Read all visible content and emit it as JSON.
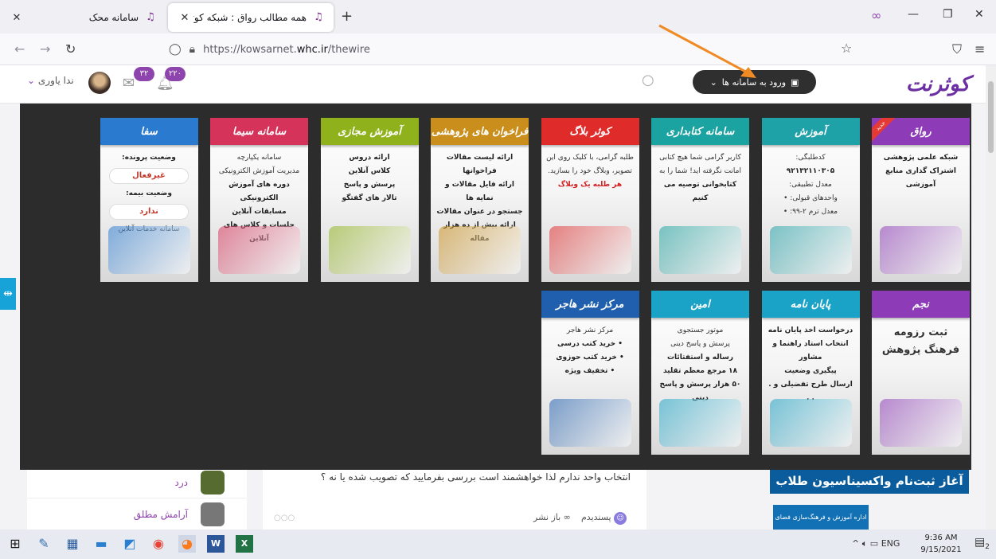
{
  "browser": {
    "tabs": [
      {
        "title": "سامانه محک",
        "active": false
      },
      {
        "title": "همه مطالب رواق : شبکه کوثر نت",
        "active": true
      }
    ],
    "new_tab": "+",
    "url_prefix": "https://kowsarnet.",
    "url_host": "whc.ir",
    "url_path": "/thewire"
  },
  "header": {
    "logo": "کوثرنت",
    "systems_button": "ورود به سامانه ها",
    "user_name": "ندا یاوری",
    "notif_count": "۲۲۰",
    "msg_count": "۳۲"
  },
  "cards_row1": [
    {
      "title": "رواق",
      "color": "#8e3bb8",
      "new": "جدید",
      "lines": [
        {
          "t": "شبکه علمی پژوهشی",
          "s": "bold"
        },
        {
          "t": "اشتراک گذاری منابع آموزشی",
          "s": "bold"
        }
      ]
    },
    {
      "title": "آموزش",
      "color": "#1fa1a8",
      "lines": [
        {
          "t": "کدطلبگی:",
          "s": ""
        },
        {
          "t": "۹۲۱۳۲۱۱۰۳۰۵",
          "s": "bold"
        },
        {
          "t": "معدل تطبیقی:",
          "s": ""
        },
        {
          "t": "واحدهای قبولی: •",
          "s": ""
        },
        {
          "t": "معدل ترم ۲-۹۹: •",
          "s": ""
        }
      ]
    },
    {
      "title": "سامانه کتابداری",
      "color": "#1aa3a0",
      "lines": [
        {
          "t": "کاربر گرامی شما هیچ کتابی",
          "s": ""
        },
        {
          "t": "امانت نگرفته اید! شما را به",
          "s": ""
        },
        {
          "t": "کتابخوانی توصیه می کنیم",
          "s": "bold"
        }
      ]
    },
    {
      "title": "کوثر بلاگ",
      "color": "#e02b2b",
      "lines": [
        {
          "t": "طلبه گرامی، با کلیک روی این",
          "s": ""
        },
        {
          "t": "تصویر، وبلاگ خود را بسازید.",
          "s": ""
        },
        {
          "t": "هر طلبه یک وبلاگ",
          "s": "red"
        }
      ]
    },
    {
      "title": "فراخوان های پژوهشی",
      "color": "#c98e1b",
      "lines": [
        {
          "t": "ارائه لیست مقالات فراخوانها",
          "s": "bold"
        },
        {
          "t": "ارائه فایل مقالات و نمایه ها",
          "s": "bold"
        },
        {
          "t": "جستجو در عنوان مقالات",
          "s": "bold"
        },
        {
          "t": "ارائه بیش از ده هزار مقاله",
          "s": "bold"
        }
      ]
    },
    {
      "title": "آموزش مجازی",
      "color": "#8fb21c",
      "lines": [
        {
          "t": "ارائه دروس",
          "s": "bold"
        },
        {
          "t": "کلاس آنلاین",
          "s": "bold"
        },
        {
          "t": "پرسش و پاسخ",
          "s": "bold"
        },
        {
          "t": "تالار های گفتگو",
          "s": "bold"
        }
      ]
    },
    {
      "title": "سامانه سیما",
      "color": "#d6335a",
      "lines": [
        {
          "t": "سامانه یکپارچه",
          "s": ""
        },
        {
          "t": "مدیریت آموزش الکترونیکی",
          "s": ""
        },
        {
          "t": "دوره های آموزش الکترونیکی",
          "s": "bold"
        },
        {
          "t": "مسابقات آنلاین",
          "s": "bold"
        },
        {
          "t": "جلسات و کلاس های آنلاین",
          "s": "bold"
        }
      ]
    },
    {
      "title": "سفا",
      "color": "#2a7ad0",
      "lines": [
        {
          "t": "وضعیت پرونده:",
          "s": "bold"
        },
        {
          "t": "غیرفعال",
          "s": "pill"
        },
        {
          "t": "وضعیت بیمه:",
          "s": "bold"
        },
        {
          "t": "ندارد",
          "s": "pill"
        },
        {
          "t": "سامانه خدمات آنلاین",
          "s": ""
        }
      ]
    }
  ],
  "cards_row2": [
    {
      "title": "نجم",
      "color": "#8e3bb8",
      "lines": [
        {
          "t": "ثبت رزومه",
          "s": "big"
        },
        {
          "t": "فرهنگ پژوهش",
          "s": "big"
        }
      ]
    },
    {
      "title": "پایان نامه",
      "color": "#1aa3c6",
      "lines": [
        {
          "t": "درخواست اخذ پایان نامه",
          "s": "bold"
        },
        {
          "t": "انتخاب استاد راهنما و مشاور",
          "s": "bold"
        },
        {
          "t": "پیگیری وضعیت",
          "s": "bold"
        },
        {
          "t": "ارسال طرح تفضیلی و . . .",
          "s": "bold"
        }
      ]
    },
    {
      "title": "امین",
      "color": "#1aa3c6",
      "lines": [
        {
          "t": "موتور جستجوی",
          "s": ""
        },
        {
          "t": "پرسش و پاسخ دینی",
          "s": ""
        },
        {
          "t": "رساله و استفتائات",
          "s": "bold"
        },
        {
          "t": "۱۸ مرجع معظم تقلید",
          "s": "bold"
        },
        {
          "t": "۵۰ هزار پرسش و پاسخ دینی",
          "s": "bold"
        }
      ]
    },
    {
      "title": "مرکز نشر هاجر",
      "color": "#1f5fae",
      "lines": [
        {
          "t": "مرکز نشر هاجر",
          "s": ""
        },
        {
          "t": "• خرید کتب درسی",
          "s": "bold"
        },
        {
          "t": "• خرید کتب حوزوی",
          "s": "bold"
        },
        {
          "t": "• تخفیف ویژه",
          "s": "bold"
        }
      ]
    }
  ],
  "page": {
    "left_items": [
      {
        "name": "درد"
      },
      {
        "name": "آرامش مطلق"
      }
    ],
    "post_text": "انتخاب واحد ندارم لذا خواهشمند است بررسی بفرمایید که تصویب شده یا نه ؟",
    "like_label": "پسندیدم",
    "share_label": "باز نشر",
    "banner_text": "آغاز ثبت‌نام واکسیناسیون طلاب",
    "banner2_text": "اداره آموزش و فرهنگ‌سازی فضای مجازی"
  },
  "taskbar": {
    "lang": "ENG",
    "time": "9:36 AM",
    "date": "9/15/2021",
    "notif": "2"
  }
}
